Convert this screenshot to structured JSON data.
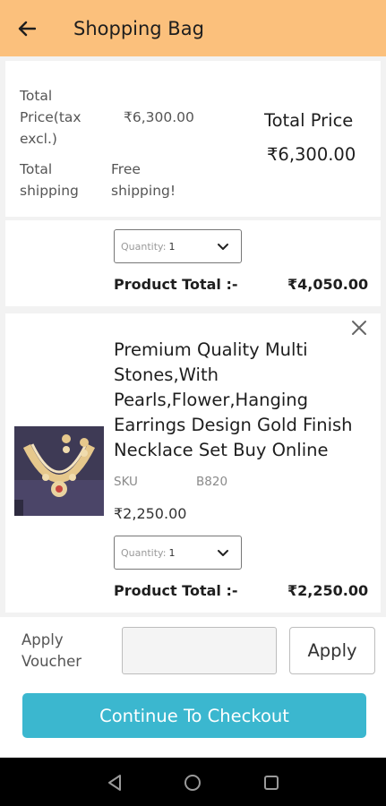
{
  "header": {
    "title": "Shopping Bag",
    "background": "#fbc07c",
    "back_icon": "arrow-left-icon"
  },
  "summary": {
    "total_price_label": "Total Price(tax excl.)",
    "total_price_value": "₹6,300.00",
    "total_shipping_label": "Total shipping",
    "total_shipping_value": "Free shipping!",
    "grand_total_title": "Total Price",
    "grand_total_value": "₹6,300.00"
  },
  "cart_items": [
    {
      "quantity_label": "Quantity:",
      "quantity_value": "1",
      "product_total_label": "Product Total :-",
      "product_total_value": "₹4,050.00"
    },
    {
      "name": "Premium Quality Multi Stones,With Pearls,Flower,Hanging Earrings Design Gold Finish Necklace Set Buy Online",
      "sku_label": "SKU",
      "sku_value": "B820",
      "price": "₹2,250.00",
      "quantity_label": "Quantity:",
      "quantity_value": "1",
      "product_total_label": "Product Total :-",
      "product_total_value": "₹2,250.00",
      "close_icon": "close-icon"
    }
  ],
  "voucher": {
    "label": "Apply Voucher",
    "input_value": "",
    "apply_label": "Apply"
  },
  "checkout": {
    "label": "Continue To Checkout",
    "color": "#3bb7cf"
  },
  "navbar": {
    "icons": [
      "back-triangle-icon",
      "home-circle-icon",
      "recents-square-icon"
    ]
  }
}
